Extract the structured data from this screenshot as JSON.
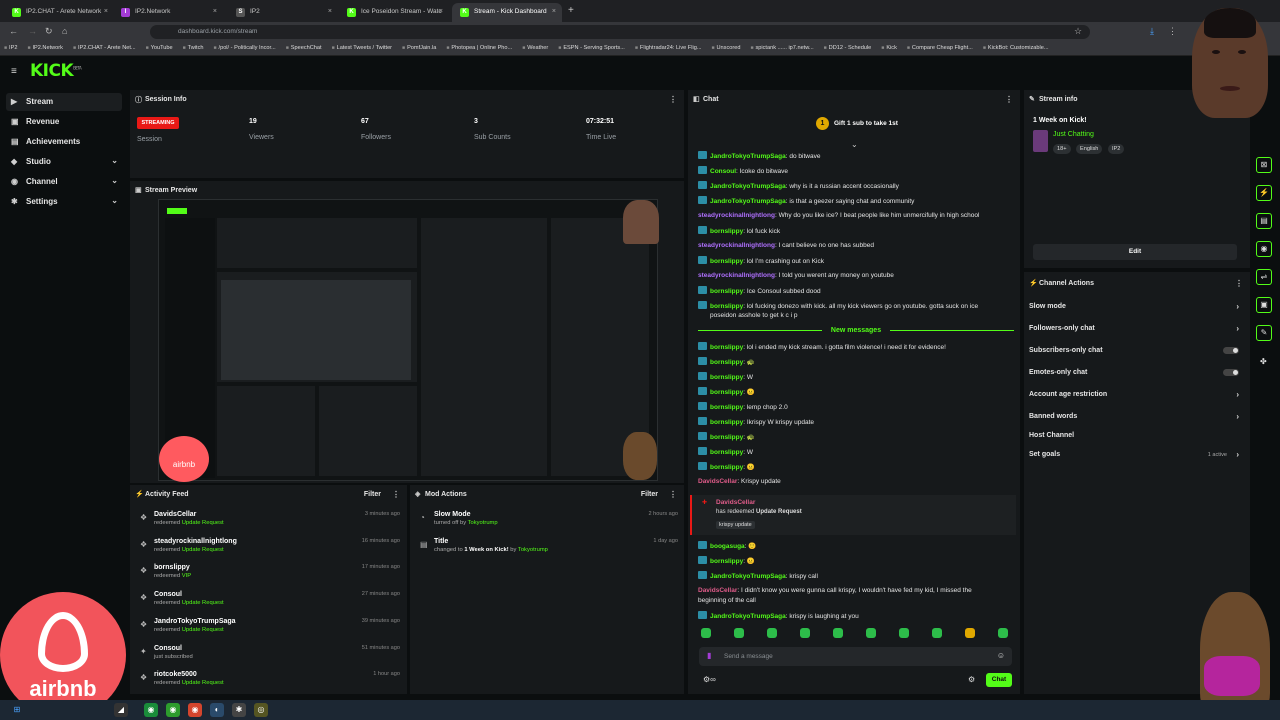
{
  "browser": {
    "tabs": [
      {
        "title": "IP2.CHAT - Arete Network",
        "color": "#53fc18",
        "glyph": "K"
      },
      {
        "title": "IP2.Network",
        "color": "#a43cd6",
        "glyph": "I"
      },
      {
        "title": "IP2",
        "color": "#555555",
        "glyph": "S"
      },
      {
        "title": "Ice Poseidon Stream - Watc",
        "color": "#53fc18",
        "glyph": "K"
      },
      {
        "title": "Stream - Kick Dashboard",
        "color": "#53fc18",
        "glyph": "K"
      }
    ],
    "url": "dashboard.kick.com/stream",
    "bookmarks": [
      "IP2",
      "IP2.Network",
      "IP2.CHAT - Arete Net...",
      "YouTube",
      "Twitch",
      "/pol/ - Politically Incor...",
      "SpeechChat",
      "Latest Tweets / Twitter",
      "PomfJain.la",
      "Photopea | Online Pho...",
      "Weather",
      "ESPN - Serving Sports...",
      "Flightradar24: Live Flig...",
      "Unscored",
      "spictank ...... ip7.netw...",
      "DD12 - Schedule",
      "Kick",
      "Compare Cheap Flight...",
      "KickBot: Customizable..."
    ]
  },
  "kick": {
    "logo": "KICK",
    "logo_badge": "BETA"
  },
  "sidebar": {
    "items": [
      {
        "label": "Stream",
        "icon": "video-icon",
        "glyph": "▶",
        "active": true,
        "expandable": false
      },
      {
        "label": "Revenue",
        "icon": "revenue-icon",
        "glyph": "▣",
        "active": false,
        "expandable": false
      },
      {
        "label": "Achievements",
        "icon": "trophy-icon",
        "glyph": "▤",
        "active": false,
        "expandable": false
      },
      {
        "label": "Studio",
        "icon": "studio-icon",
        "glyph": "◆",
        "active": false,
        "expandable": true
      },
      {
        "label": "Channel",
        "icon": "channel-icon",
        "glyph": "◉",
        "active": false,
        "expandable": true
      },
      {
        "label": "Settings",
        "icon": "gear-icon",
        "glyph": "✱",
        "active": false,
        "expandable": true
      }
    ]
  },
  "session": {
    "title": "Session Info",
    "status": "STREAMING",
    "status_label": "Session",
    "stats": [
      {
        "value": "19",
        "label": "Viewers"
      },
      {
        "value": "67",
        "label": "Followers"
      },
      {
        "value": "3",
        "label": "Sub Counts"
      },
      {
        "value": "07:32:51",
        "label": "Time Live"
      }
    ]
  },
  "preview": {
    "title": "Stream Preview",
    "overlay_brand": "airbnb"
  },
  "activity": {
    "title": "Activity Feed",
    "filter": "Filter",
    "items": [
      {
        "name": "DavidsCellar",
        "action": "redeemed",
        "detail": "Update Request",
        "time": "3 minutes ago"
      },
      {
        "name": "steadyrockinallnightlong",
        "action": "redeemed",
        "detail": "Update Request",
        "time": "16 minutes ago"
      },
      {
        "name": "bornslippy",
        "action": "redeemed",
        "detail": "VIP",
        "time": "17 minutes ago"
      },
      {
        "name": "Consoul",
        "action": "redeemed",
        "detail": "Update Request",
        "time": "27 minutes ago"
      },
      {
        "name": "JandroTokyoTrumpSaga",
        "action": "redeemed",
        "detail": "Update Request",
        "time": "39 minutes ago"
      },
      {
        "name": "Consoul",
        "action": "just subscribed",
        "detail": "",
        "time": "51 minutes ago"
      },
      {
        "name": "riotcoke5000",
        "action": "redeemed",
        "detail": "Update Request",
        "time": "1 hour ago"
      }
    ]
  },
  "mod_actions": {
    "title": "Mod Actions",
    "filter": "Filter",
    "items": [
      {
        "title": "Slow Mode",
        "prefix": "turned off by",
        "value": "",
        "by": "Tokyotrump",
        "time": "2 hours ago"
      },
      {
        "title": "Title",
        "prefix": "changed to",
        "value": "1 Week on Kick!",
        "by": "Tokyotrump",
        "time": "1 day ago"
      }
    ]
  },
  "chat": {
    "title": "Chat",
    "pinned": "Gift 1 sub to take 1st",
    "new_messages_label": "New messages",
    "messages_top": [
      {
        "user": "JandroTokyoTrumpSaga",
        "color": "#53fc18",
        "badge": true,
        "text": "do bitwave"
      },
      {
        "user": "Consoul",
        "color": "#53fc18",
        "badge": true,
        "text": "Icoke do bitwave"
      },
      {
        "user": "JandroTokyoTrumpSaga",
        "color": "#53fc18",
        "badge": true,
        "text": "why is it a russian accent occasionally"
      },
      {
        "user": "JandroTokyoTrumpSaga",
        "color": "#53fc18",
        "badge": true,
        "text": "is that a geezer saying chat and community"
      },
      {
        "user": "steadyrockinallnightlong",
        "color": "#b070ff",
        "badge": false,
        "text": "Why do you like ice? I beat people like him unmercifully in high school"
      },
      {
        "user": "bornslippy",
        "color": "#53fc18",
        "badge": true,
        "text": "lol fuck kick"
      },
      {
        "user": "steadyrockinallnightlong",
        "color": "#b070ff",
        "badge": false,
        "text": "I cant believe no one has subbed"
      },
      {
        "user": "bornslippy",
        "color": "#53fc18",
        "badge": true,
        "text": "lol I'm crashing out on Kick"
      },
      {
        "user": "steadyrockinallnightlong",
        "color": "#b070ff",
        "badge": false,
        "text": "I told you werent any money on youtube"
      },
      {
        "user": "bornslippy",
        "color": "#53fc18",
        "badge": true,
        "text": "Ice Consoul subbed dood"
      },
      {
        "user": "bornslippy",
        "color": "#53fc18",
        "badge": true,
        "text": "lol fucking donezo with kick. all my kick viewers go on youtube. gotta suck on ice"
      },
      {
        "user": "",
        "color": "#e6e6e6",
        "badge": false,
        "text": "poseidon asshole to get k c i p"
      }
    ],
    "messages_bottom": [
      {
        "user": "bornslippy",
        "color": "#53fc18",
        "badge": true,
        "text": "lol i ended my kick stream. i gotta film violence! i need it for evidence!"
      },
      {
        "user": "bornslippy",
        "color": "#53fc18",
        "badge": true,
        "text": "🐢"
      },
      {
        "user": "bornslippy",
        "color": "#53fc18",
        "badge": true,
        "text": "W"
      },
      {
        "user": "bornslippy",
        "color": "#53fc18",
        "badge": true,
        "text": "😐"
      },
      {
        "user": "bornslippy",
        "color": "#53fc18",
        "badge": true,
        "text": "lemp chop 2.0"
      },
      {
        "user": "bornslippy",
        "color": "#53fc18",
        "badge": true,
        "text": "Ikrispy W krispy update"
      },
      {
        "user": "bornslippy",
        "color": "#53fc18",
        "badge": true,
        "text": "🐢"
      },
      {
        "user": "bornslippy",
        "color": "#53fc18",
        "badge": true,
        "text": "W"
      },
      {
        "user": "bornslippy",
        "color": "#53fc18",
        "badge": true,
        "text": "😐"
      },
      {
        "user": "DavidsCellar",
        "color": "#e05c8a",
        "badge": false,
        "text": "Krispy update"
      }
    ],
    "redeem": {
      "user": "DavidsCellar",
      "text": "has redeemed",
      "reward": "Update Request",
      "note": "krispy update"
    },
    "messages_after": [
      {
        "user": "boogasuga",
        "color": "#53fc18",
        "badge": true,
        "text": "🙂"
      },
      {
        "user": "bornslippy",
        "color": "#53fc18",
        "badge": true,
        "text": "😐"
      },
      {
        "user": "JandroTokyoTrumpSaga",
        "color": "#53fc18",
        "badge": true,
        "text": "krispy call"
      },
      {
        "user": "DavidsCellar",
        "color": "#e05c8a",
        "badge": false,
        "text": "I didn't know you were gunna call krispy, I wouldn't have fed my kid, I missed the"
      },
      {
        "user": "",
        "color": "#e6e6e6",
        "badge": false,
        "text": "beginning of the call"
      },
      {
        "user": "JandroTokyoTrumpSaga",
        "color": "#53fc18",
        "badge": true,
        "text": "krispy is laughing at you"
      }
    ],
    "input_placeholder": "Send a message",
    "send_label": "Chat"
  },
  "stream_info": {
    "title": "Stream info",
    "stream_title": "1 Week on Kick!",
    "category": "Just Chatting",
    "tags": [
      "18+",
      "English",
      "IP2"
    ],
    "edit_label": "Edit"
  },
  "channel_actions": {
    "title": "Channel Actions",
    "items": [
      {
        "label": "Slow mode",
        "kind": "arrow"
      },
      {
        "label": "Followers-only chat",
        "kind": "arrow"
      },
      {
        "label": "Subscribers-only chat",
        "kind": "toggle"
      },
      {
        "label": "Emotes-only chat",
        "kind": "toggle"
      },
      {
        "label": "Account age restriction",
        "kind": "arrow"
      },
      {
        "label": "Banned words",
        "kind": "arrow"
      },
      {
        "label": "Host Channel",
        "kind": "none"
      },
      {
        "label": "Set goals",
        "kind": "arrow",
        "extra": "1 active"
      }
    ]
  },
  "overlay": {
    "brand": "airbnb"
  }
}
